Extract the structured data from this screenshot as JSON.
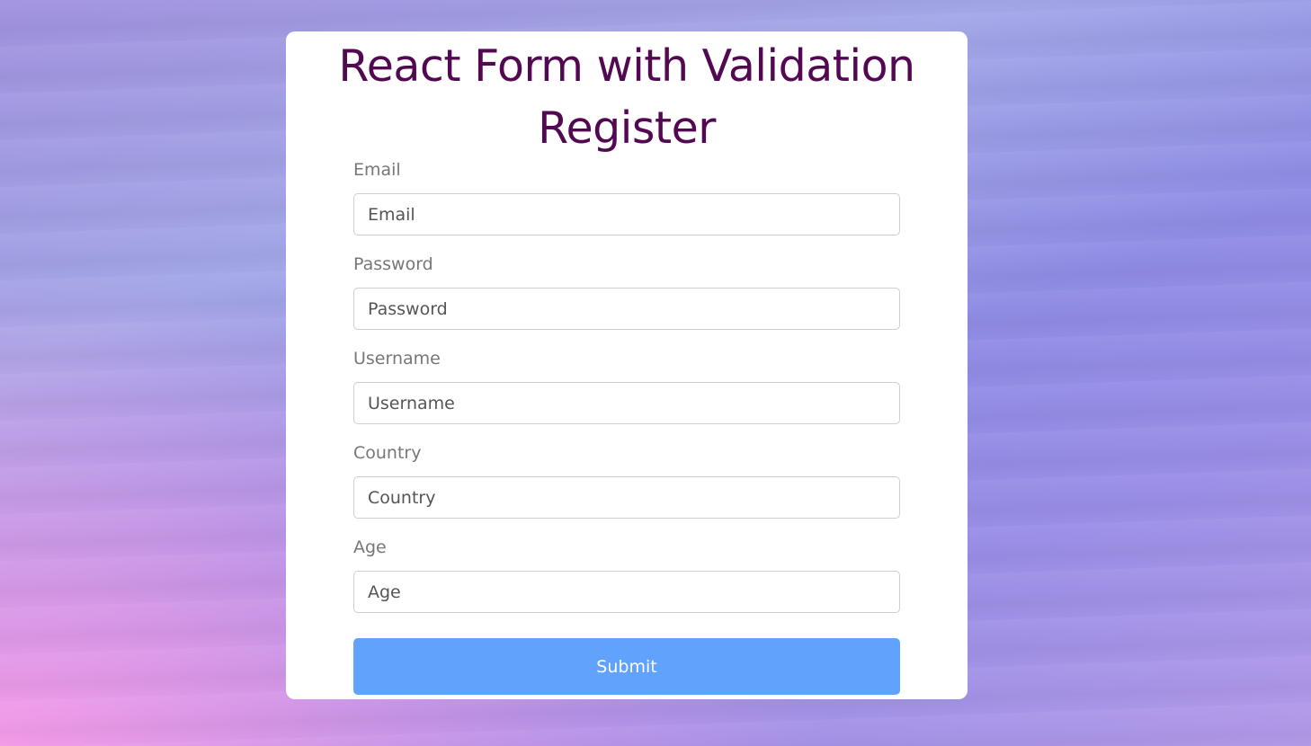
{
  "page": {
    "title_line1": "React Form with Validation",
    "title_line2": "Register"
  },
  "colors": {
    "title": "#520952",
    "submit_bg": "#61a2fd",
    "label": "#777777"
  },
  "form": {
    "fields": [
      {
        "label": "Email",
        "placeholder": "Email",
        "value": ""
      },
      {
        "label": "Password",
        "placeholder": "Password",
        "value": ""
      },
      {
        "label": "Username",
        "placeholder": "Username",
        "value": ""
      },
      {
        "label": "Country",
        "placeholder": "Country",
        "value": ""
      },
      {
        "label": "Age",
        "placeholder": "Age",
        "value": ""
      }
    ],
    "submit_label": "Submit"
  }
}
